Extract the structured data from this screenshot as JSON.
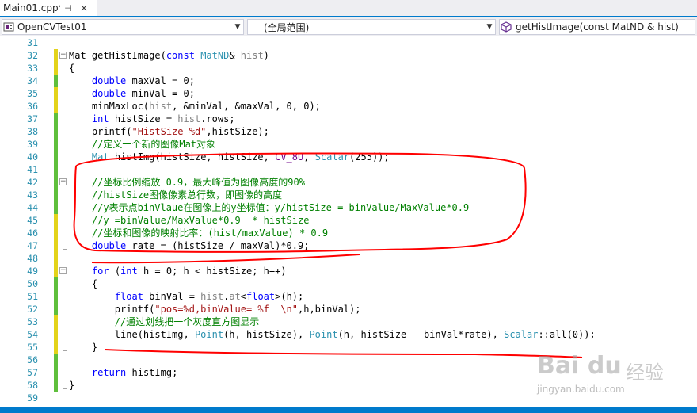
{
  "tab": {
    "title": "Main01.cpp*",
    "pin": "⊣",
    "close": "×"
  },
  "nav": {
    "project": "OpenCVTest01",
    "scope": "(全局范围)",
    "member": "getHistImage(const MatND & hist)"
  },
  "colors": {
    "accent": "#007acc",
    "line_number": "#2b91af",
    "keyword": "#0000ff",
    "comment": "#008000",
    "string": "#a31515",
    "macro": "#6f008a",
    "annotation": "#ff0000"
  },
  "icons": {
    "project": "project-icon",
    "member": "method-cube-icon"
  },
  "watermark": {
    "logo": "Bai du",
    "cn": "经验",
    "url": "jingyan.baidu.com"
  },
  "lines": [
    {
      "n": "31",
      "t": []
    },
    {
      "n": "32",
      "t": [
        [
          "fn",
          "Mat getHistImage("
        ],
        [
          "kw",
          "const"
        ],
        [
          "fn",
          " "
        ],
        [
          "ty",
          "MatND"
        ],
        [
          "fn",
          "& "
        ],
        [
          "pr",
          "hist"
        ],
        [
          "fn",
          ")"
        ]
      ]
    },
    {
      "n": "33",
      "t": [
        [
          "fn",
          "{"
        ]
      ]
    },
    {
      "n": "34",
      "t": [
        [
          "fn",
          "    "
        ],
        [
          "kw",
          "double"
        ],
        [
          "fn",
          " maxVal = 0;"
        ]
      ]
    },
    {
      "n": "35",
      "t": [
        [
          "fn",
          "    "
        ],
        [
          "kw",
          "double"
        ],
        [
          "fn",
          " minVal = 0;"
        ]
      ]
    },
    {
      "n": "36",
      "t": [
        [
          "fn",
          "    minMaxLoc("
        ],
        [
          "pr",
          "hist"
        ],
        [
          "fn",
          ", &minVal, &maxVal, 0, 0);"
        ]
      ]
    },
    {
      "n": "37",
      "t": [
        [
          "fn",
          "    "
        ],
        [
          "kw",
          "int"
        ],
        [
          "fn",
          " histSize = "
        ],
        [
          "pr",
          "hist"
        ],
        [
          "fn",
          ".rows;"
        ]
      ]
    },
    {
      "n": "38",
      "t": [
        [
          "fn",
          "    printf("
        ],
        [
          "st",
          "\"HistSize %d\""
        ],
        [
          "fn",
          ",histSize);"
        ]
      ]
    },
    {
      "n": "39",
      "t": [
        [
          "cm",
          "    //定义一个新的图像Mat对象"
        ]
      ]
    },
    {
      "n": "40",
      "t": [
        [
          "fn",
          "    "
        ],
        [
          "ty",
          "Mat"
        ],
        [
          "fn",
          " histImg(histSize, histSize, "
        ],
        [
          "mc",
          "CV_8U"
        ],
        [
          "fn",
          ", "
        ],
        [
          "ty",
          "Scalar"
        ],
        [
          "fn",
          "(255));"
        ]
      ]
    },
    {
      "n": "41",
      "t": []
    },
    {
      "n": "42",
      "t": [
        [
          "cm",
          "    //坐标比例缩放 0.9，最大峰值为图像高度的90%"
        ]
      ]
    },
    {
      "n": "43",
      "t": [
        [
          "cm",
          "    //histSize图像像素总行数，即图像的高度"
        ]
      ]
    },
    {
      "n": "44",
      "t": [
        [
          "cm",
          "    //y表示点binVlaue在图像上的y坐标值：y/histSize = binValue/MaxValue*0.9"
        ]
      ]
    },
    {
      "n": "45",
      "t": [
        [
          "cm",
          "    //y =binValue/MaxValue*0.9  * histSize"
        ]
      ]
    },
    {
      "n": "46",
      "t": [
        [
          "cm",
          "    //坐标和图像的映射比率：(hist/maxValue) * 0.9"
        ]
      ]
    },
    {
      "n": "47",
      "t": [
        [
          "fn",
          "    "
        ],
        [
          "kw",
          "double"
        ],
        [
          "fn",
          " rate = (histSize / maxVal)*0.9;"
        ]
      ]
    },
    {
      "n": "48",
      "t": []
    },
    {
      "n": "49",
      "t": [
        [
          "fn",
          "    "
        ],
        [
          "kw",
          "for"
        ],
        [
          "fn",
          " ("
        ],
        [
          "kw",
          "int"
        ],
        [
          "fn",
          " h = 0; h < histSize; h++)"
        ]
      ]
    },
    {
      "n": "50",
      "t": [
        [
          "fn",
          "    {"
        ]
      ]
    },
    {
      "n": "51",
      "t": [
        [
          "fn",
          "        "
        ],
        [
          "kw",
          "float"
        ],
        [
          "fn",
          " binVal = "
        ],
        [
          "pr",
          "hist"
        ],
        [
          "fn",
          "."
        ],
        [
          "pr",
          "at"
        ],
        [
          "fn",
          "<"
        ],
        [
          "kw",
          "float"
        ],
        [
          "fn",
          ">(h);"
        ]
      ]
    },
    {
      "n": "52",
      "t": [
        [
          "fn",
          "        printf("
        ],
        [
          "st",
          "\"pos=%d,binValue= %f  \\n\""
        ],
        [
          "fn",
          ",h,binVal);"
        ]
      ]
    },
    {
      "n": "53",
      "t": [
        [
          "cm",
          "        //通过划线把一个灰度直方图显示"
        ]
      ]
    },
    {
      "n": "54",
      "t": [
        [
          "fn",
          "        line(histImg, "
        ],
        [
          "ty",
          "Point"
        ],
        [
          "fn",
          "(h, histSize), "
        ],
        [
          "ty",
          "Point"
        ],
        [
          "fn",
          "(h, histSize - binVal*rate), "
        ],
        [
          "ty",
          "Scalar"
        ],
        [
          "fn",
          "::all(0));"
        ]
      ]
    },
    {
      "n": "55",
      "t": [
        [
          "fn",
          "    }"
        ]
      ]
    },
    {
      "n": "56",
      "t": []
    },
    {
      "n": "57",
      "t": [
        [
          "fn",
          "    "
        ],
        [
          "kw",
          "return"
        ],
        [
          "fn",
          " histImg;"
        ]
      ]
    },
    {
      "n": "58",
      "t": [
        [
          "fn",
          "}"
        ]
      ]
    },
    {
      "n": "59",
      "t": []
    }
  ]
}
